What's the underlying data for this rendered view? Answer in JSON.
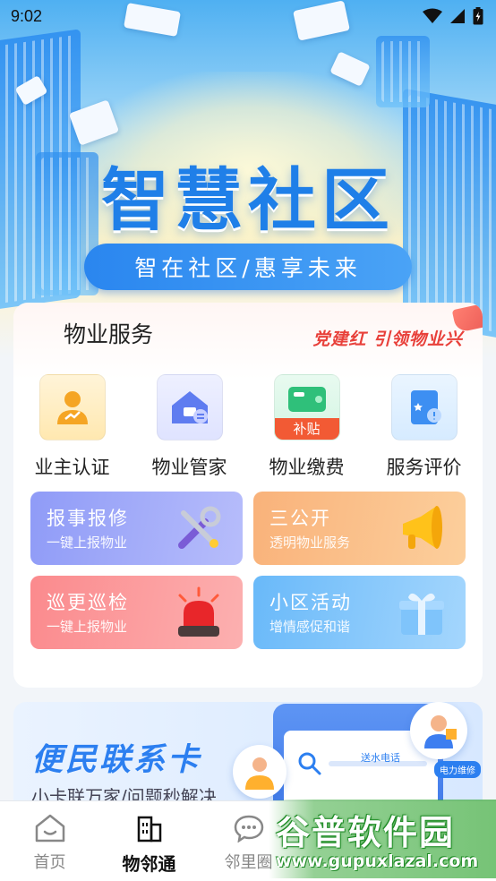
{
  "status_bar": {
    "time": "9:02"
  },
  "hero": {
    "title": "智慧社区",
    "slogan": "智在社区/惠享未来"
  },
  "services": {
    "title": "物业服务",
    "party_slogan": "党建红 引领物业兴",
    "items": [
      {
        "label": "业主认证",
        "icon": "owner-verify-icon"
      },
      {
        "label": "物业管家",
        "icon": "house-steward-icon"
      },
      {
        "label": "物业缴费",
        "icon": "wallet-subsidy-icon",
        "badge": "补贴"
      },
      {
        "label": "服务评价",
        "icon": "service-review-icon"
      }
    ],
    "functions": [
      {
        "title": "报事报修",
        "subtitle": "一键上报物业",
        "icon": "tools-icon"
      },
      {
        "title": "三公开",
        "subtitle": "透明物业服务",
        "icon": "megaphone-icon"
      },
      {
        "title": "巡更巡检",
        "subtitle": "一键上报物业",
        "icon": "alarm-light-icon"
      },
      {
        "title": "小区活动",
        "subtitle": "增情感促和谐",
        "icon": "gift-box-icon"
      }
    ]
  },
  "banner": {
    "title": "便民联系卡",
    "subtitle": "小卡联万家/问题秒解决",
    "tag_water": "送水电话",
    "tag_power": "电力维修"
  },
  "bottom_nav": {
    "items": [
      {
        "label": "首页",
        "icon": "home-icon",
        "active": false
      },
      {
        "label": "物邻通",
        "icon": "buildings-icon",
        "active": true
      },
      {
        "label": "邻里圈",
        "icon": "chat-bubble-icon",
        "active": false
      }
    ]
  },
  "watermark": {
    "title": "谷普软件园",
    "url": "www.gupuxlazal.com"
  },
  "colors": {
    "brand_blue": "#1f7fe8",
    "party_red": "#e8403a",
    "watermark_green": "#1d8a24"
  }
}
